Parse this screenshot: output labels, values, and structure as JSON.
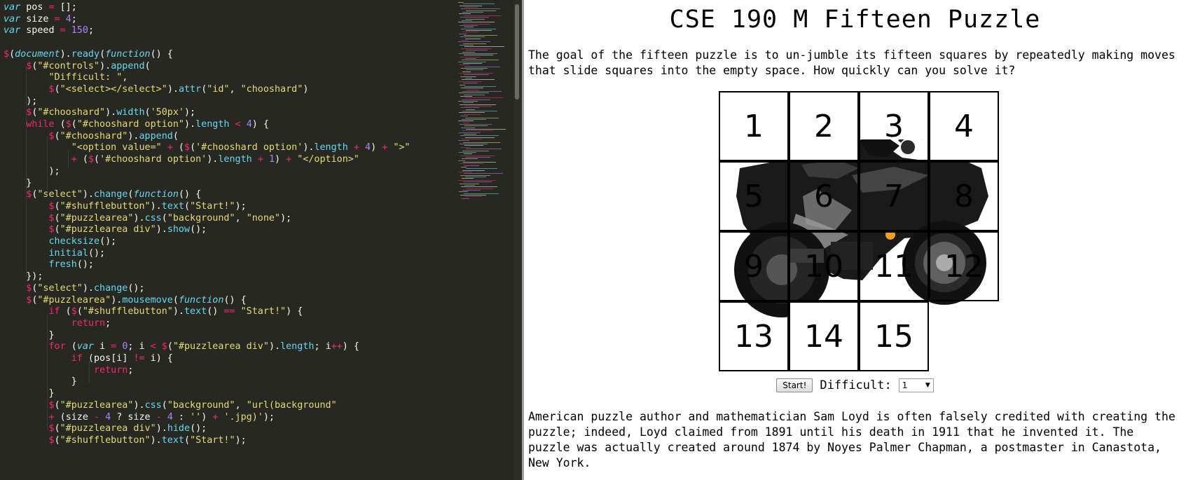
{
  "colors": {
    "editor_bg": "#272822",
    "keyword": "#f92672",
    "function": "#66d9ef",
    "string": "#e6db74",
    "number": "#ae81ff"
  },
  "editor": {
    "code_lines": [
      "var pos = [];",
      "var size = 4;",
      "var speed = 150;",
      "",
      "$(document).ready(function() {",
      "    $(\"#controls\").append(",
      "        \"Difficult: \",",
      "        $(\"<select></select>\").attr(\"id\", \"chooshard\")",
      "    );",
      "    $(\"#chooshard\").width('50px');",
      "    while ($(\"#chooshard option\").length < 4) {",
      "        $(\"#chooshard\").append(",
      "            \"<option value=\" + ($('#chooshard option').length + 4) + \">\"",
      "            + ($('#chooshard option').length + 1) + \"</option>\"",
      "        );",
      "    }",
      "    $(\"select\").change(function() {",
      "        $(\"#shufflebutton\").text(\"Start!\");",
      "        $(\"#puzzlearea\").css(\"background\", \"none\");",
      "        $(\"#puzzlearea div\").show();",
      "        checksize();",
      "        initial();",
      "        fresh();",
      "    });",
      "    $(\"select\").change();",
      "    $(\"#puzzlearea\").mousemove(function() {",
      "        if ($(\"#shufflebutton\").text() == \"Start!\") {",
      "            return;",
      "        }",
      "        for (var i = 0; i < $(\"#puzzlearea div\").length; i++) {",
      "            if (pos[i] != i) {",
      "                return;",
      "            }",
      "        }",
      "        $(\"#puzzlearea\").css(\"background\", \"url(background\"",
      "        + (size - 4 ? size - 4 : '') + '.jpg)');",
      "        $(\"#puzzlearea div\").hide();",
      "        $(\"#shufflebutton\").text(\"Start!\");"
    ]
  },
  "page": {
    "title": "CSE 190 M Fifteen Puzzle",
    "intro": "The goal of the fifteen puzzle is to un-jumble its fifteen squares by repeatedly making moves that slide squares into the empty space. How quickly can you solve it?",
    "tiles": [
      "1",
      "2",
      "3",
      "4",
      "5",
      "6",
      "7",
      "8",
      "9",
      "10",
      "11",
      "12",
      "13",
      "14",
      "15"
    ],
    "controls": {
      "shuffle_label": "Start!",
      "difficulty_label": "Difficult:",
      "difficulty_value": "1",
      "dropdown_icon": "triangle-down-icon"
    },
    "history": "American puzzle author and mathematician Sam Loyd is often falsely credited with creating the puzzle; indeed, Loyd claimed from 1891 until his death in 1911 that he invented it. The puzzle was actually created around 1874 by Noyes Palmer Chapman, a postmaster in Canastota, New York."
  }
}
